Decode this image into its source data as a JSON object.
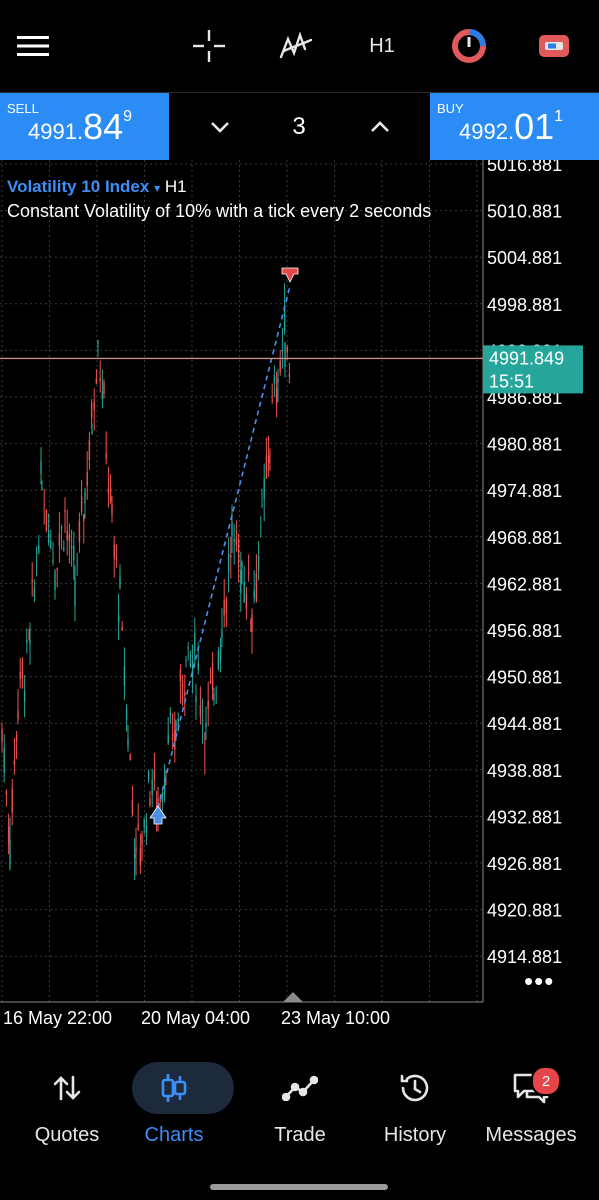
{
  "toolbar": {
    "timeframe": "H1",
    "icons": [
      "menu-icon",
      "crosshair-icon",
      "indicators-icon",
      "timeframe",
      "objects-icon",
      "oneclick-toggle-icon"
    ]
  },
  "trade_bar": {
    "sell": {
      "label": "SELL",
      "price_small": "4991.",
      "price_big": "84",
      "price_sup": "9"
    },
    "buy": {
      "label": "BUY",
      "price_small": "4992.",
      "price_big": "01",
      "price_sup": "1"
    },
    "volume": "3"
  },
  "chart": {
    "symbol": "Volatility 10 Index",
    "symbol_caret": "▾",
    "timeframe": "H1",
    "description": "Constant Volatility of 10% with a tick every 2 seconds",
    "price_labels": [
      "5016.881",
      "5010.881",
      "5004.881",
      "4998.881",
      "4992.881",
      "4986.881",
      "4980.881",
      "4974.881",
      "4968.881",
      "4962.881",
      "4956.881",
      "4950.881",
      "4944.881",
      "4938.881",
      "4932.881",
      "4926.881",
      "4920.881",
      "4914.881"
    ],
    "current_price": "4991.849",
    "countdown": "15:51",
    "time_labels": [
      "16 May 22:00",
      "20 May 04:00",
      "23 May 10:00"
    ],
    "more_label": "•••",
    "colors": {
      "bull": "#26a69a",
      "bear": "#ef5350",
      "grid": "#3a3a3a",
      "price_line": "#c98b85",
      "price_tag": "#26a69a",
      "trade_line": "#4d8fe8"
    }
  },
  "nav": {
    "items": [
      {
        "label": "Quotes",
        "icon": "quotes-icon"
      },
      {
        "label": "Charts",
        "icon": "charts-icon"
      },
      {
        "label": "Trade",
        "icon": "trade-icon"
      },
      {
        "label": "History",
        "icon": "history-icon"
      },
      {
        "label": "Messages",
        "icon": "messages-icon"
      }
    ],
    "messages_badge": "2"
  }
}
